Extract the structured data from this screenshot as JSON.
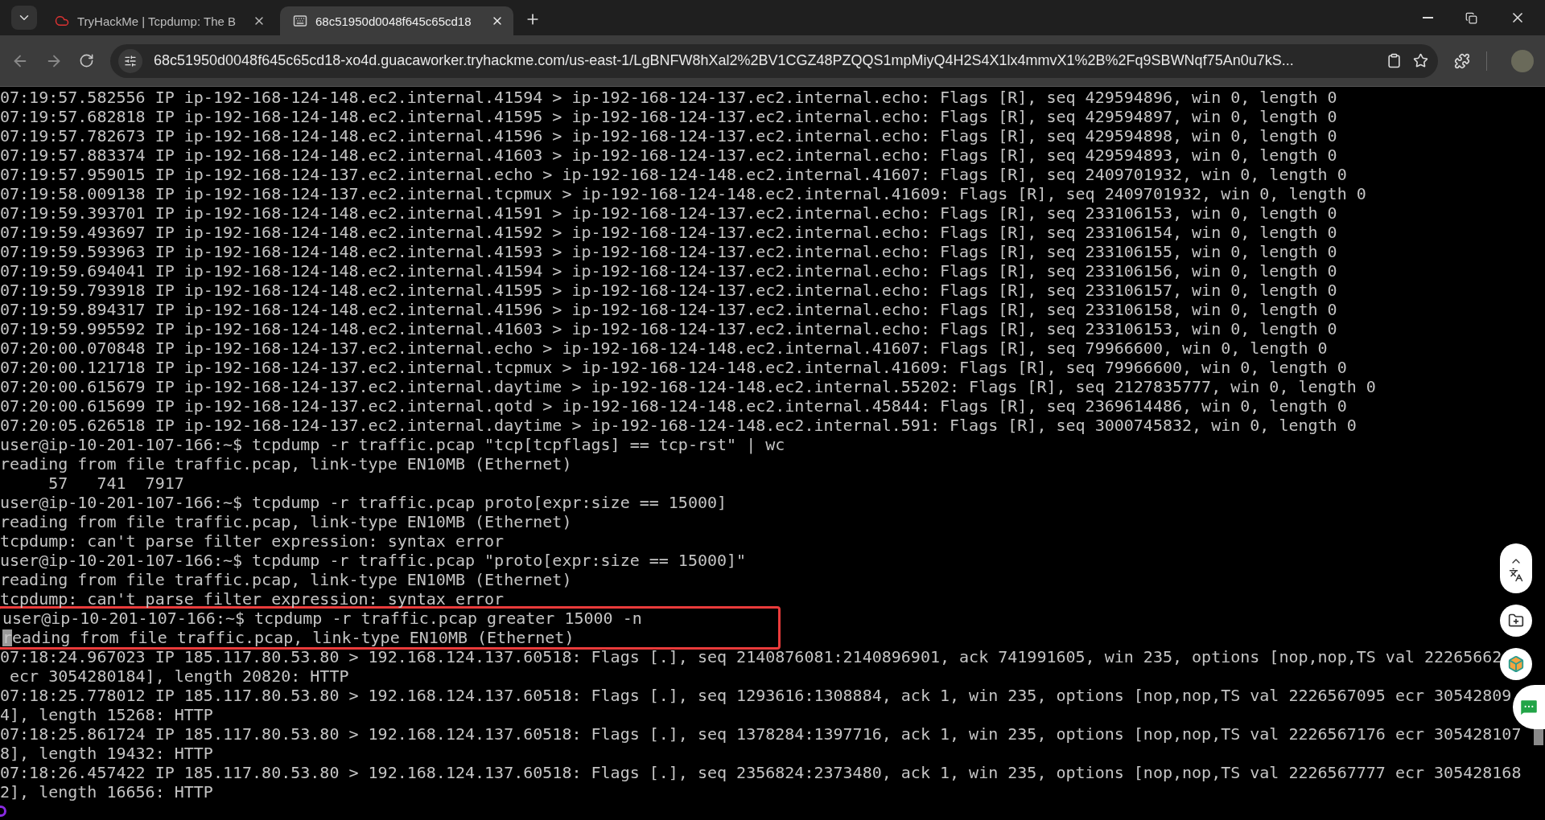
{
  "browser": {
    "tabs": [
      {
        "title": "TryHackMe | Tcpdump: The B",
        "selected": false
      },
      {
        "title": "68c51950d0048f645c65cd18",
        "selected": true
      }
    ],
    "url": "68c51950d0048f645c65cd18-xo4d.guacaworker.tryhackme.com/us-east-1/LgBNFW8hXal2%2BV1CGZ48PZQQS1mpMiyQ4H2S4X1lx4mmvX1%2B%2Fq9SBWNqf75An0u7kS..."
  },
  "terminal": {
    "lines": [
      {
        "text": "07:19:57.582556 IP ip-192-168-124-148.ec2.internal.41594 > ip-192-168-124-137.ec2.internal.echo: Flags [R], seq 429594896, win 0, length 0",
        "boxed": false,
        "cursor": false
      },
      {
        "text": "07:19:57.682818 IP ip-192-168-124-148.ec2.internal.41595 > ip-192-168-124-137.ec2.internal.echo: Flags [R], seq 429594897, win 0, length 0",
        "boxed": false,
        "cursor": false
      },
      {
        "text": "07:19:57.782673 IP ip-192-168-124-148.ec2.internal.41596 > ip-192-168-124-137.ec2.internal.echo: Flags [R], seq 429594898, win 0, length 0",
        "boxed": false,
        "cursor": false
      },
      {
        "text": "07:19:57.883374 IP ip-192-168-124-148.ec2.internal.41603 > ip-192-168-124-137.ec2.internal.echo: Flags [R], seq 429594893, win 0, length 0",
        "boxed": false,
        "cursor": false
      },
      {
        "text": "07:19:57.959015 IP ip-192-168-124-137.ec2.internal.echo > ip-192-168-124-148.ec2.internal.41607: Flags [R], seq 2409701932, win 0, length 0",
        "boxed": false,
        "cursor": false
      },
      {
        "text": "07:19:58.009138 IP ip-192-168-124-137.ec2.internal.tcpmux > ip-192-168-124-148.ec2.internal.41609: Flags [R], seq 2409701932, win 0, length 0",
        "boxed": false,
        "cursor": false
      },
      {
        "text": "07:19:59.393701 IP ip-192-168-124-148.ec2.internal.41591 > ip-192-168-124-137.ec2.internal.echo: Flags [R], seq 233106153, win 0, length 0",
        "boxed": false,
        "cursor": false
      },
      {
        "text": "07:19:59.493697 IP ip-192-168-124-148.ec2.internal.41592 > ip-192-168-124-137.ec2.internal.echo: Flags [R], seq 233106154, win 0, length 0",
        "boxed": false,
        "cursor": false
      },
      {
        "text": "07:19:59.593963 IP ip-192-168-124-148.ec2.internal.41593 > ip-192-168-124-137.ec2.internal.echo: Flags [R], seq 233106155, win 0, length 0",
        "boxed": false,
        "cursor": false
      },
      {
        "text": "07:19:59.694041 IP ip-192-168-124-148.ec2.internal.41594 > ip-192-168-124-137.ec2.internal.echo: Flags [R], seq 233106156, win 0, length 0",
        "boxed": false,
        "cursor": false
      },
      {
        "text": "07:19:59.793918 IP ip-192-168-124-148.ec2.internal.41595 > ip-192-168-124-137.ec2.internal.echo: Flags [R], seq 233106157, win 0, length 0",
        "boxed": false,
        "cursor": false
      },
      {
        "text": "07:19:59.894317 IP ip-192-168-124-148.ec2.internal.41596 > ip-192-168-124-137.ec2.internal.echo: Flags [R], seq 233106158, win 0, length 0",
        "boxed": false,
        "cursor": false
      },
      {
        "text": "07:19:59.995592 IP ip-192-168-124-148.ec2.internal.41603 > ip-192-168-124-137.ec2.internal.echo: Flags [R], seq 233106153, win 0, length 0",
        "boxed": false,
        "cursor": false
      },
      {
        "text": "07:20:00.070848 IP ip-192-168-124-137.ec2.internal.echo > ip-192-168-124-148.ec2.internal.41607: Flags [R], seq 79966600, win 0, length 0",
        "boxed": false,
        "cursor": false
      },
      {
        "text": "07:20:00.121718 IP ip-192-168-124-137.ec2.internal.tcpmux > ip-192-168-124-148.ec2.internal.41609: Flags [R], seq 79966600, win 0, length 0",
        "boxed": false,
        "cursor": false
      },
      {
        "text": "07:20:00.615679 IP ip-192-168-124-137.ec2.internal.daytime > ip-192-168-124-148.ec2.internal.55202: Flags [R], seq 2127835777, win 0, length 0",
        "boxed": false,
        "cursor": false
      },
      {
        "text": "07:20:00.615699 IP ip-192-168-124-137.ec2.internal.qotd > ip-192-168-124-148.ec2.internal.45844: Flags [R], seq 2369614486, win 0, length 0",
        "boxed": false,
        "cursor": false
      },
      {
        "text": "07:20:05.626518 IP ip-192-168-124-137.ec2.internal.daytime > ip-192-168-124-148.ec2.internal.591: Flags [R], seq 3000745832, win 0, length 0",
        "boxed": false,
        "cursor": false
      },
      {
        "text": "user@ip-10-201-107-166:~$ tcpdump -r traffic.pcap \"tcp[tcpflags] == tcp-rst\" | wc",
        "boxed": false,
        "cursor": false
      },
      {
        "text": "reading from file traffic.pcap, link-type EN10MB (Ethernet)",
        "boxed": false,
        "cursor": false
      },
      {
        "text": "     57   741  7917",
        "boxed": false,
        "cursor": false
      },
      {
        "text": "user@ip-10-201-107-166:~$ tcpdump -r traffic.pcap proto[expr:size == 15000]",
        "boxed": false,
        "cursor": false
      },
      {
        "text": "reading from file traffic.pcap, link-type EN10MB (Ethernet)",
        "boxed": false,
        "cursor": false
      },
      {
        "text": "tcpdump: can't parse filter expression: syntax error",
        "boxed": false,
        "cursor": false
      },
      {
        "text": "user@ip-10-201-107-166:~$ tcpdump -r traffic.pcap \"proto[expr:size == 15000]\"",
        "boxed": false,
        "cursor": false
      },
      {
        "text": "reading from file traffic.pcap, link-type EN10MB (Ethernet)",
        "boxed": false,
        "cursor": false
      },
      {
        "text": "tcpdump: can't parse filter expression: syntax error",
        "boxed": false,
        "cursor": false
      },
      {
        "text": "user@ip-10-201-107-166:~$ tcpdump -r traffic.pcap greater 15000 -n",
        "boxed": true,
        "cursor": false
      },
      {
        "text": "reading from file traffic.pcap, link-type EN10MB (Ethernet)",
        "boxed": true,
        "cursor": true
      },
      {
        "text": "07:18:24.967023 IP 185.117.80.53.80 > 192.168.124.137.60518: Flags [.], seq 2140876081:2140896901, ack 741991605, win 235, options [nop,nop,TS val 22265662",
        "boxed": false,
        "cursor": false
      },
      {
        "text": " ecr 3054280184], length 20820: HTTP",
        "boxed": false,
        "cursor": false
      },
      {
        "text": "07:18:25.778012 IP 185.117.80.53.80 > 192.168.124.137.60518: Flags [.], seq 1293616:1308884, ack 1, win 235, options [nop,nop,TS val 2226567095 ecr 30542809",
        "boxed": false,
        "cursor": false
      },
      {
        "text": "4], length 15268: HTTP",
        "boxed": false,
        "cursor": false
      },
      {
        "text": "07:18:25.861724 IP 185.117.80.53.80 > 192.168.124.137.60518: Flags [.], seq 1378284:1397716, ack 1, win 235, options [nop,nop,TS val 2226567176 ecr 305428107",
        "boxed": false,
        "cursor": false
      },
      {
        "text": "8], length 19432: HTTP",
        "boxed": false,
        "cursor": false
      },
      {
        "text": "07:18:26.457422 IP 185.117.80.53.80 > 192.168.124.137.60518: Flags [.], seq 2356824:2373480, ack 1, win 235, options [nop,nop,TS val 2226567777 ecr 305428168",
        "boxed": false,
        "cursor": false
      },
      {
        "text": "2], length 16656: HTTP",
        "boxed": false,
        "cursor": false
      }
    ]
  }
}
